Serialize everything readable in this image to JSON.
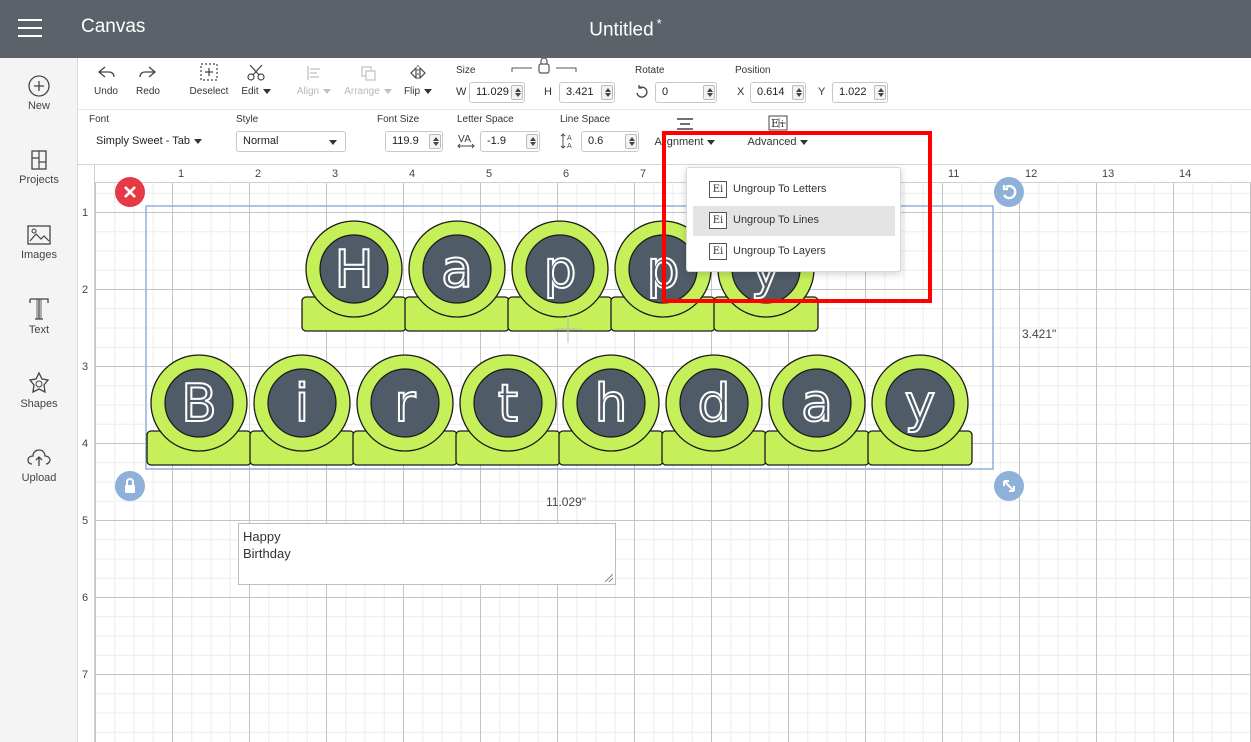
{
  "titlebar": {
    "app_name": "Canvas",
    "doc_title": "Untitled",
    "unsaved_marker": "*"
  },
  "sidebar": [
    {
      "label": "New",
      "icon": "plus-circle-icon"
    },
    {
      "label": "Projects",
      "icon": "projects-icon"
    },
    {
      "label": "Images",
      "icon": "image-icon"
    },
    {
      "label": "Text",
      "icon": "text-icon"
    },
    {
      "label": "Shapes",
      "icon": "shapes-icon"
    },
    {
      "label": "Upload",
      "icon": "upload-icon"
    }
  ],
  "toolbar": {
    "undo": "Undo",
    "redo": "Redo",
    "deselect": "Deselect",
    "edit": "Edit",
    "align": "Align",
    "arrange": "Arrange",
    "flip": "Flip",
    "size_label": "Size",
    "w_label": "W",
    "w_value": "11.029",
    "h_label": "H",
    "h_value": "3.421",
    "rotate_label": "Rotate",
    "rotate_value": "0",
    "position_label": "Position",
    "x_label": "X",
    "x_value": "0.614",
    "y_label": "Y",
    "y_value": "1.022"
  },
  "text_toolbar": {
    "font_label": "Font",
    "font_value": "Simply Sweet - Tab",
    "style_label": "Style",
    "style_value": "Normal",
    "font_size_label": "Font Size",
    "font_size_value": "119.9",
    "letter_space_label": "Letter Space",
    "letter_space_value": "-1.9",
    "line_space_label": "Line Space",
    "line_space_value": "0.6",
    "alignment": "Alignment",
    "advanced": "Advanced"
  },
  "ruler": {
    "top": [
      "1",
      "2",
      "3",
      "4",
      "5",
      "6",
      "7",
      "11",
      "12",
      "13",
      "14"
    ],
    "left": [
      "1",
      "2",
      "3",
      "4",
      "5",
      "6",
      "7"
    ]
  },
  "design": {
    "line1": [
      "H",
      "a",
      "p",
      "p",
      "y"
    ],
    "line2": [
      "B",
      "i",
      "r",
      "t",
      "h",
      "d",
      "a",
      "y"
    ],
    "width_label": "11.029\"",
    "height_label": "3.421\"",
    "colors": {
      "tab_fill": "#c5f05a",
      "circle_fill": "#4f5b66",
      "outline": "#1a1a1a",
      "selection": "#8fb1d9",
      "handle_blue": "#8fb1d9",
      "delete_red": "#e63946"
    }
  },
  "text_box": {
    "value": "Happy\nBirthday"
  },
  "advanced_menu": [
    {
      "label": "Ungroup To Letters",
      "icon_text": "Ei"
    },
    {
      "label": "Ungroup To Lines",
      "icon_text": "Ei"
    },
    {
      "label": "Ungroup To Layers",
      "icon_text": "Ei"
    }
  ],
  "highlight_color": "#ff0000"
}
